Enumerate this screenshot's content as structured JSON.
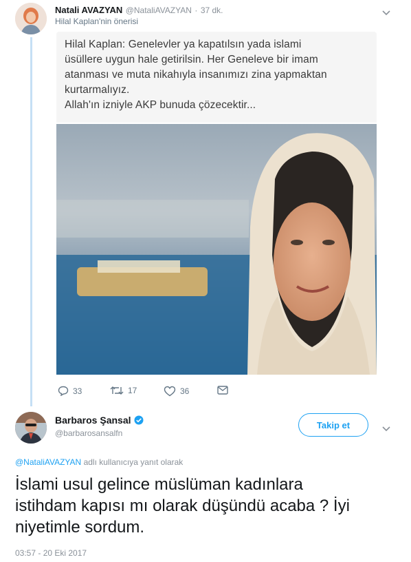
{
  "tweet1": {
    "display_name": "Natali AVAZYAN",
    "handle": "@NataliAVAZYAN",
    "separator": "·",
    "time": "37 dk.",
    "subtitle": "Hilal Kaplan'nin önerisi",
    "quote_lines": [
      "Hilal Kaplan: Genelevler ya kapatılsın yada islami",
      "üsüllere uygun hale getirilsin. Her Geneleve bir imam",
      "atanması ve muta nikahıyla insanımızı zina yapmaktan",
      "kurtarmalıyız.",
      "Allah'ın izniyle AKP bunuda çözecektir..."
    ],
    "actions": {
      "replies": "33",
      "retweets": "17",
      "likes": "36"
    }
  },
  "tweet2": {
    "display_name": "Barbaros Şansal",
    "handle": "@barbarosansalfn",
    "follow_label": "Takip et",
    "reply_prefix_handle": "@NataliAVAZYAN",
    "reply_suffix": "adlı kullanıcıya yanıt olarak",
    "text_lines": [
      "İslami usul gelince müslüman kadınlara",
      "istihdam kapısı mı olarak düşündü acaba ? İyi",
      "niyetimle sordum."
    ],
    "timestamp": "03:57 - 20 Eki 2017"
  },
  "colors": {
    "accent": "#1da1f2",
    "verified": "#1da1f2",
    "thread_line": "#c5dff5",
    "muted": "#8a9199"
  }
}
